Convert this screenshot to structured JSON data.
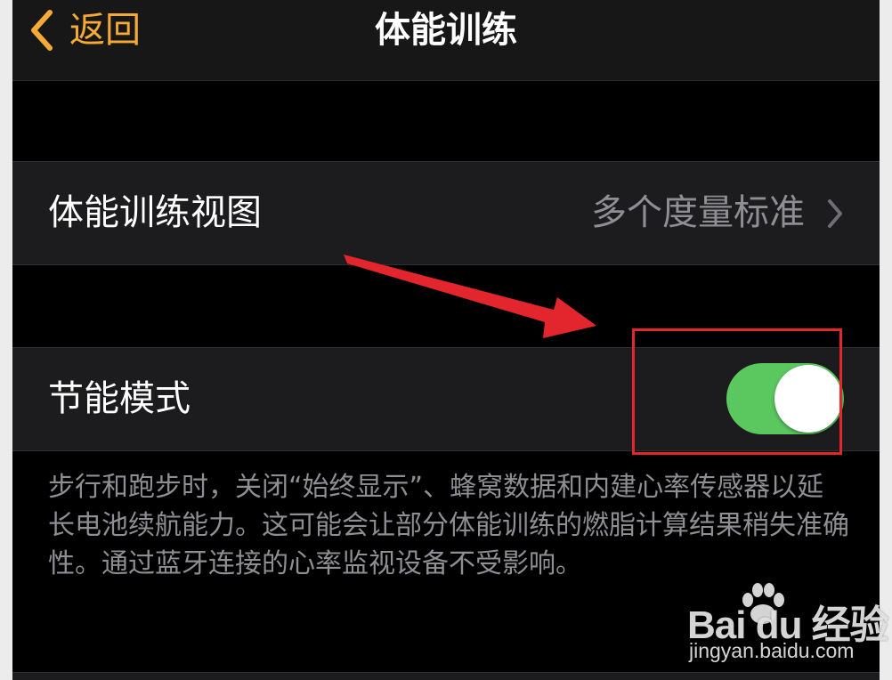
{
  "nav": {
    "back_label": "返回",
    "title": "体能训练"
  },
  "settings": {
    "workout_view": {
      "label": "体能训练视图",
      "value": "多个度量标准"
    },
    "power_saving": {
      "label": "节能模式",
      "enabled": true
    },
    "footer": "步行和跑步时，关闭“始终显示”、蜂窝数据和内建心率传感器以延长电池续航能力。这可能会让部分体能训练的燃脂计算结果稍失准确性。通过蓝牙连接的心率监视设备不受影响。"
  },
  "watermark": {
    "brand": "Bai du 经验",
    "url": "jingyan.baidu.com"
  },
  "colors": {
    "accent": "#f6a935",
    "toggle_on": "#5ac85f",
    "annotation": "#e3262d",
    "background": "#000000",
    "cell": "#1c1c1e",
    "secondary_text": "#8e8e93"
  },
  "icons": {
    "back": "chevron-left-icon",
    "disclosure": "chevron-right-icon",
    "watermark": "paw-icon"
  }
}
